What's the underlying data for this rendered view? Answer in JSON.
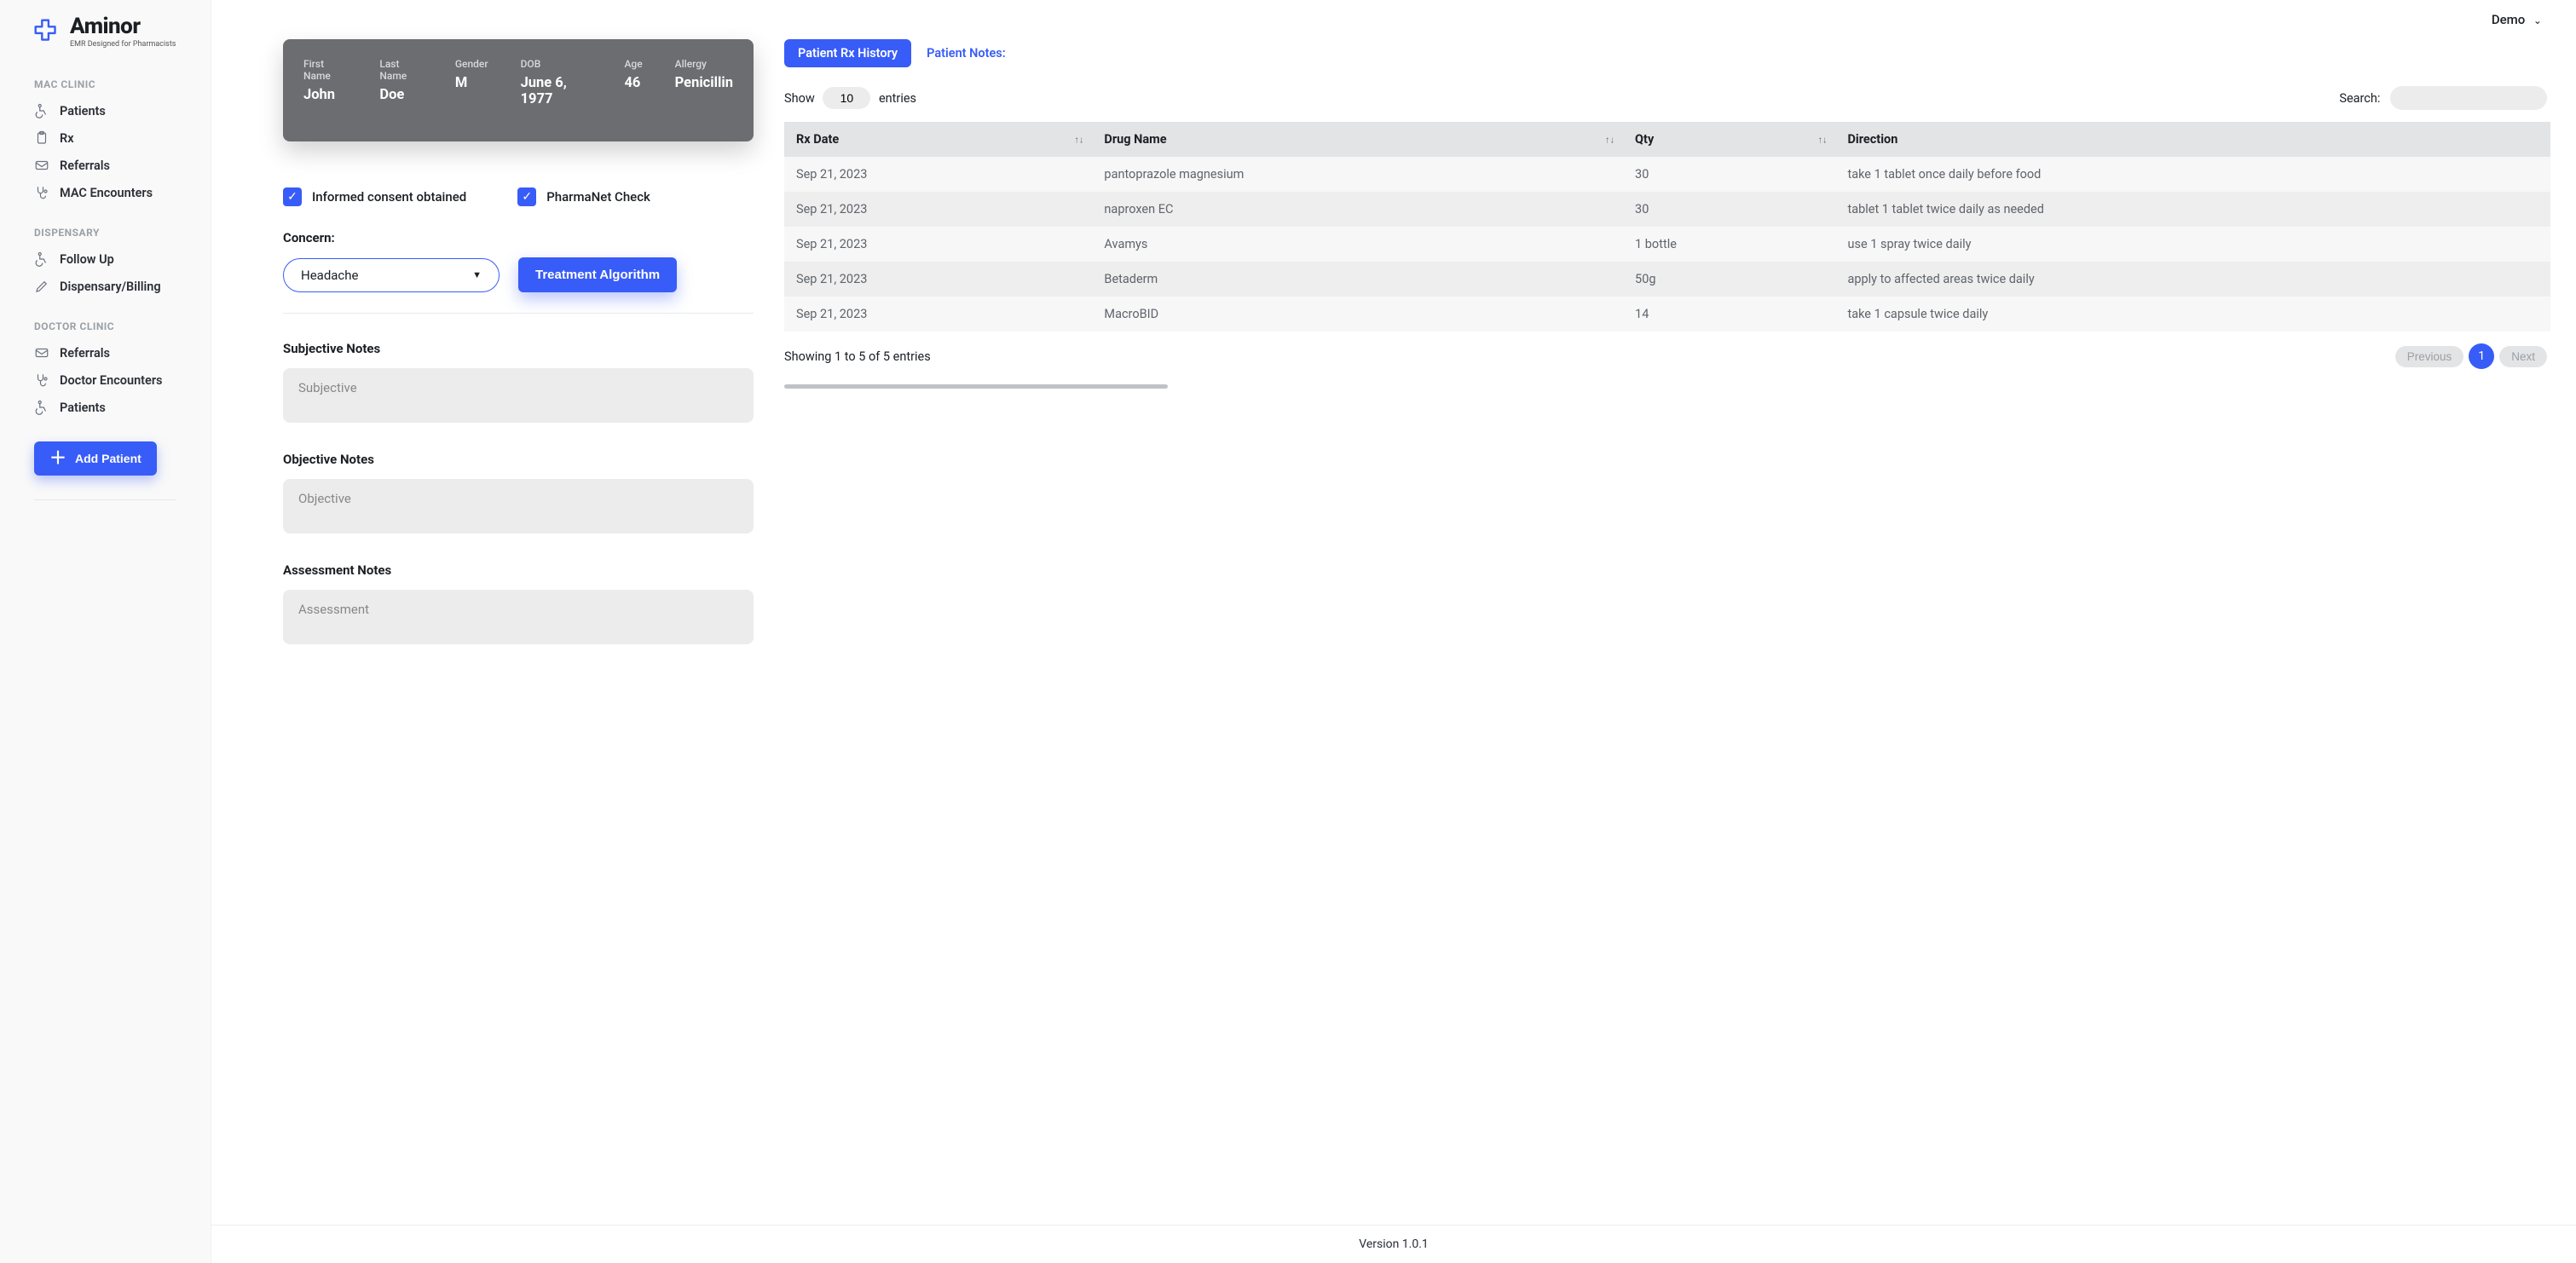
{
  "brand": {
    "name": "Aminor",
    "tagline": "EMR Designed for Pharmacists"
  },
  "topbar": {
    "user": "Demo"
  },
  "sidebar": {
    "sections": [
      {
        "title": "MAC CLINIC",
        "items": [
          "Patients",
          "Rx",
          "Referrals",
          "MAC Encounters"
        ]
      },
      {
        "title": "DISPENSARY",
        "items": [
          "Follow Up",
          "Dispensary/Billing"
        ]
      },
      {
        "title": "DOCTOR CLINIC",
        "items": [
          "Referrals",
          "Doctor Encounters",
          "Patients"
        ]
      }
    ],
    "add_patient": "Add Patient"
  },
  "patient": {
    "fields": [
      {
        "label": "First Name",
        "value": "John"
      },
      {
        "label": "Last Name",
        "value": "Doe"
      },
      {
        "label": "Gender",
        "value": "M"
      },
      {
        "label": "DOB",
        "value": "June 6, 1977"
      },
      {
        "label": "Age",
        "value": "46"
      },
      {
        "label": "Allergy",
        "value": "Penicillin"
      }
    ]
  },
  "encounter": {
    "consent_label": "Informed consent obtained",
    "pharmanet_label": "PharmaNet Check",
    "consent_checked": true,
    "pharmanet_checked": true,
    "concern_label": "Concern:",
    "concern_value": "Headache",
    "treatment_btn": "Treatment Algorithm",
    "subjective_title": "Subjective Notes",
    "subjective_placeholder": "Subjective",
    "objective_title": "Objective Notes",
    "objective_placeholder": "Objective",
    "assessment_title": "Assessment Notes",
    "assessment_placeholder": "Assessment"
  },
  "tabs": {
    "rx_history": "Patient Rx History",
    "notes": "Patient Notes:"
  },
  "table": {
    "show_label": "Show",
    "entries_label": "entries",
    "entries_value": "10",
    "search_label": "Search:",
    "headers": [
      "Rx Date",
      "Drug Name",
      "Qty",
      "Direction"
    ],
    "rows": [
      {
        "date": "Sep 21, 2023",
        "drug": "pantoprazole magnesium",
        "qty": "30",
        "dir": "take 1 tablet once daily before food"
      },
      {
        "date": "Sep 21, 2023",
        "drug": "naproxen EC",
        "qty": "30",
        "dir": "tablet 1 tablet twice daily as needed"
      },
      {
        "date": "Sep 21, 2023",
        "drug": "Avamys",
        "qty": "1 bottle",
        "dir": "use 1 spray twice daily"
      },
      {
        "date": "Sep 21, 2023",
        "drug": "Betaderm",
        "qty": "50g",
        "dir": "apply to affected areas twice daily"
      },
      {
        "date": "Sep 21, 2023",
        "drug": "MacroBID",
        "qty": "14",
        "dir": "take 1 capsule twice daily"
      }
    ],
    "showing": "Showing 1 to 5 of 5 entries",
    "prev": "Previous",
    "next": "Next",
    "current_page": "1"
  },
  "footer": {
    "version": "Version 1.0.1"
  },
  "colors": {
    "accent": "#385cf7",
    "card": "#6b6d70",
    "muted_bg": "#ececec"
  }
}
